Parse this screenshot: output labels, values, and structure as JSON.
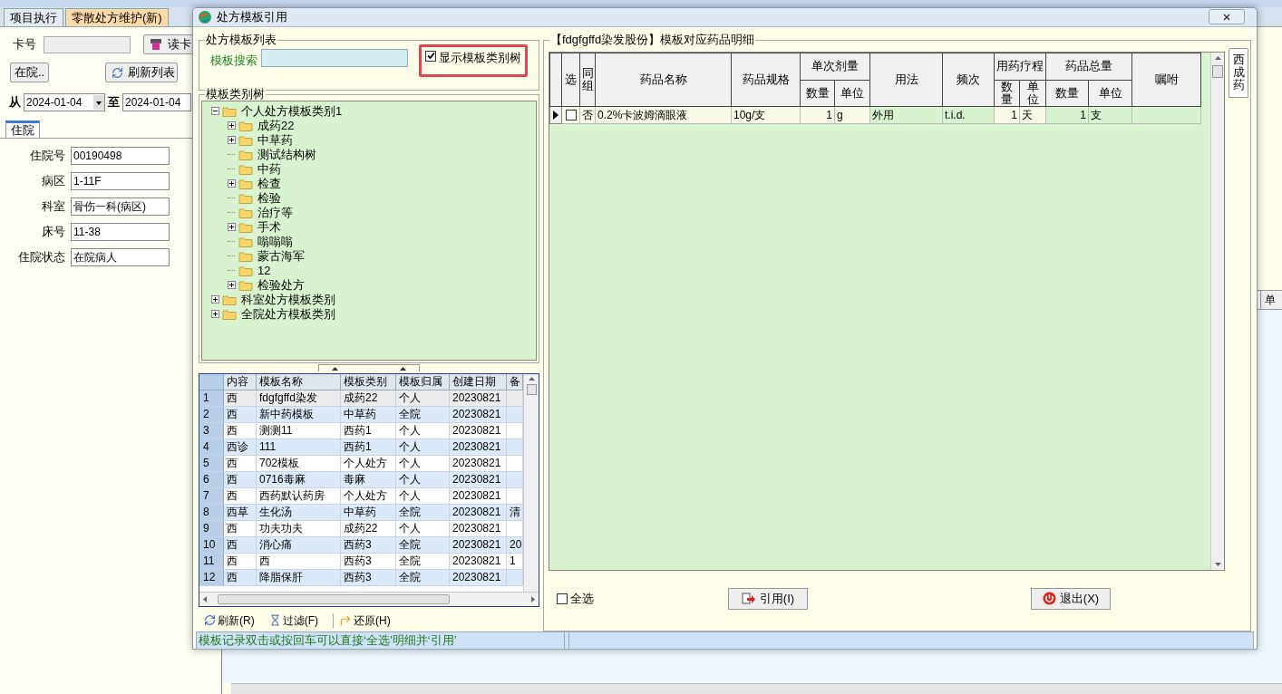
{
  "background_app": {
    "tabs": [
      {
        "label": "项目执行",
        "selected": false
      },
      {
        "label": "零散处方维护(新)",
        "selected": true
      }
    ],
    "card_label": "卡号",
    "read_card_button": "读卡",
    "inpatient_button": "在院..",
    "refresh_button": "刷新列表",
    "from_label": "从",
    "from_date": "2024-01-04",
    "to_label": "至",
    "to_date": "2024-01-04",
    "sub_tab": {
      "label": "住院",
      "selected": true
    },
    "fields": [
      {
        "label": "住院号",
        "value": "00190498"
      },
      {
        "label": "病区",
        "value": "1-11F"
      },
      {
        "label": "科室",
        "value": "骨伤一科(病区)"
      },
      {
        "label": "床号",
        "value": "11-38"
      },
      {
        "label": "住院状态",
        "value": "在院病人"
      }
    ],
    "grid_header_fragment": "单"
  },
  "dialog": {
    "title": "处方模板引用",
    "template_list": {
      "legend": "处方模板列表",
      "search_label": "模板搜索",
      "show_tree_checkbox": {
        "label": "显示模板类别树",
        "checked": true
      }
    },
    "tree": {
      "legend": "模板类别树",
      "nodes": [
        {
          "label": "个人处方模板类别1",
          "kind": "group",
          "expanded": true,
          "children": [
            {
              "label": "成药22",
              "kind": "group",
              "expanded": false
            },
            {
              "label": "中草药",
              "kind": "group",
              "expanded": false
            },
            {
              "label": "测试结构树",
              "kind": "leaf"
            },
            {
              "label": "中药",
              "kind": "leaf"
            },
            {
              "label": "检查",
              "kind": "group",
              "expanded": false
            },
            {
              "label": "检验",
              "kind": "leaf"
            },
            {
              "label": "治疗等",
              "kind": "leaf"
            },
            {
              "label": "手术",
              "kind": "group",
              "expanded": false
            },
            {
              "label": "嗡嗡嗡",
              "kind": "leaf"
            },
            {
              "label": "蒙古海军",
              "kind": "leaf"
            },
            {
              "label": "12",
              "kind": "leaf"
            },
            {
              "label": "检验处方",
              "kind": "group",
              "expanded": false
            }
          ]
        },
        {
          "label": "科室处方模板类别",
          "kind": "group",
          "expanded": false
        },
        {
          "label": "全院处方模板类别",
          "kind": "group",
          "expanded": false
        }
      ]
    },
    "templates": {
      "columns": [
        "内容",
        "模板名称",
        "模板类别",
        "模板归属",
        "创建日期",
        "备"
      ],
      "rows": [
        {
          "number": "1",
          "selected": true,
          "cells": [
            "西",
            "fdgfgffd染发",
            "成药22",
            "个人",
            "20230821",
            ""
          ]
        },
        {
          "number": "2",
          "selected": false,
          "cells": [
            "西",
            "新中药模板",
            "中草药",
            "全院",
            "20230821",
            ""
          ]
        },
        {
          "number": "3",
          "selected": false,
          "cells": [
            "西",
            "测测11",
            "西药1",
            "个人",
            "20230821",
            ""
          ]
        },
        {
          "number": "4",
          "selected": false,
          "cells": [
            "西诊",
            "111",
            "西药1",
            "个人",
            "20230821",
            ""
          ]
        },
        {
          "number": "5",
          "selected": false,
          "cells": [
            "西",
            "702模板",
            "个人处方",
            "个人",
            "20230821",
            ""
          ]
        },
        {
          "number": "6",
          "selected": false,
          "cells": [
            "西",
            "0716毒麻",
            "毒麻",
            "个人",
            "20230821",
            ""
          ]
        },
        {
          "number": "7",
          "selected": false,
          "cells": [
            "西",
            "西药默认药房",
            "个人处方",
            "个人",
            "20230821",
            ""
          ]
        },
        {
          "number": "8",
          "selected": false,
          "cells": [
            "西草",
            "生化汤",
            "中草药",
            "全院",
            "20230821",
            "清"
          ]
        },
        {
          "number": "9",
          "selected": false,
          "cells": [
            "西",
            "功夫功夫",
            "成药22",
            "个人",
            "20230821",
            ""
          ]
        },
        {
          "number": "10",
          "selected": false,
          "cells": [
            "西",
            "消心痛",
            "西药3",
            "全院",
            "20230821",
            "20"
          ]
        },
        {
          "number": "11",
          "selected": false,
          "cells": [
            "西",
            "西",
            "西药3",
            "全院",
            "20230821",
            "1"
          ]
        },
        {
          "number": "12",
          "selected": false,
          "cells": [
            "西",
            "降脂保肝",
            "西药3",
            "全院",
            "20230821",
            ""
          ]
        }
      ]
    },
    "toolbar": [
      "刷新(R)",
      "过滤(F)",
      "还原(H)"
    ],
    "detail": {
      "legend": "【fdgfgffd染发股份】模板对应药品明细",
      "columns": [
        {
          "label": "选"
        },
        {
          "label": "同组"
        },
        {
          "label": "药品名称"
        },
        {
          "label": "药品规格"
        },
        {
          "label": "单次剂量",
          "colspan": 2,
          "sub": [
            "数量",
            "单位"
          ]
        },
        {
          "label": "用法"
        },
        {
          "label": "频次"
        },
        {
          "label": "用药疗程",
          "colspan": 2,
          "sub": [
            "数量",
            "单位"
          ]
        },
        {
          "label": "药品总量",
          "colspan": 2,
          "sub": [
            "数量",
            "单位"
          ]
        },
        {
          "label": "嘱咐"
        }
      ],
      "rows": [
        {
          "current": true,
          "checked": false,
          "cells": [
            "",
            "否",
            "0.2%卡波姆滴眼液",
            "10g/支",
            "1",
            "g",
            "外用",
            "t.i.d.",
            "1",
            "天",
            "1",
            "支"
          ]
        }
      ],
      "side_tab": {
        "label": "西成药",
        "selected": true
      },
      "select_all": {
        "label": "全选",
        "checked": false
      },
      "quote_button": "引用(I)",
      "exit_button": "退出(X)"
    },
    "status": "模板记录双击或按回车可以直接‘全选’明细并‘引用’"
  }
}
